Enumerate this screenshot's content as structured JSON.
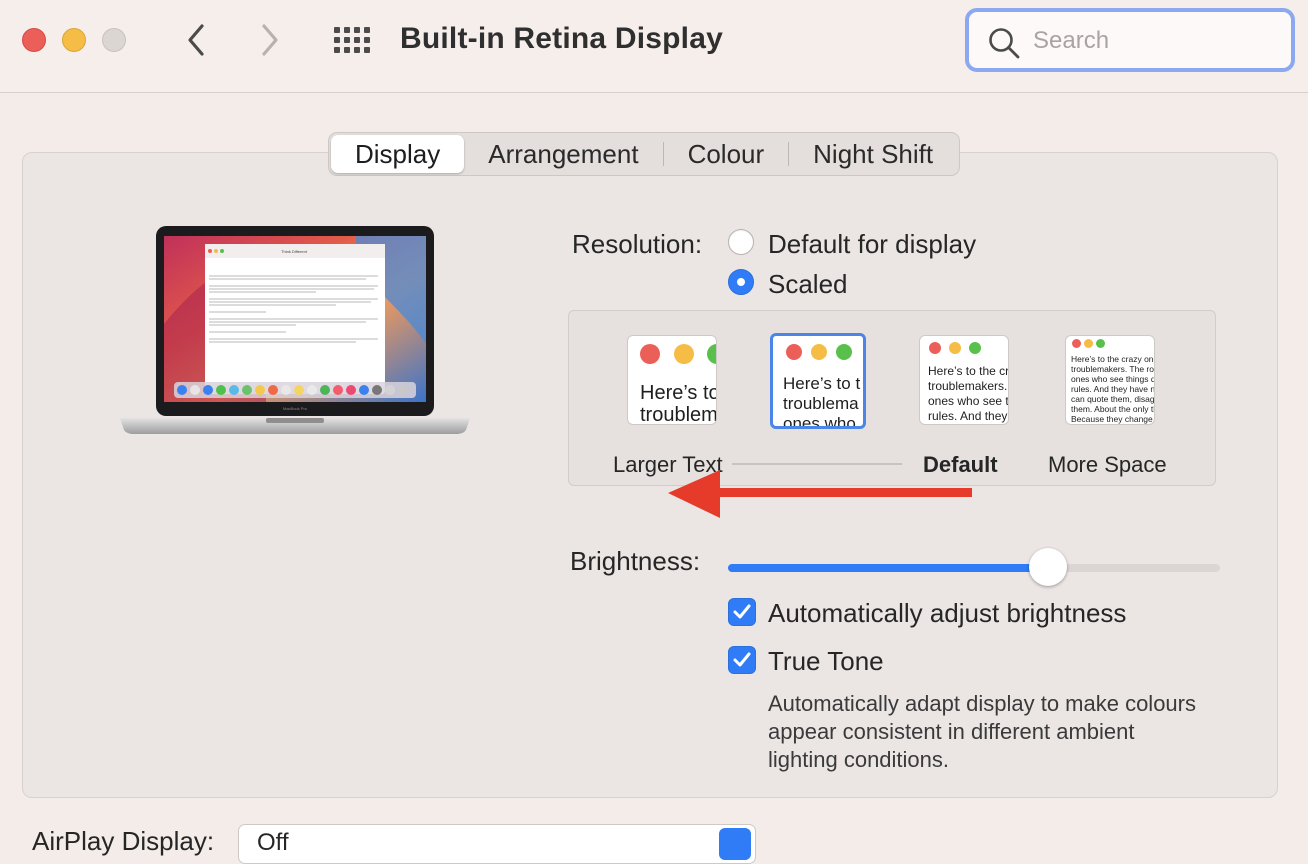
{
  "window": {
    "title": "Built-in Retina Display"
  },
  "toolbar": {
    "back_icon": "chevron-left-icon",
    "forward_icon": "chevron-right-icon",
    "grid_icon": "grid-icon",
    "search": {
      "placeholder": "Search",
      "value": ""
    }
  },
  "tabs": [
    {
      "label": "Display",
      "active": true
    },
    {
      "label": "Arrangement",
      "active": false
    },
    {
      "label": "Colour",
      "active": false
    },
    {
      "label": "Night Shift",
      "active": false
    }
  ],
  "resolution": {
    "label": "Resolution:",
    "options": [
      {
        "label": "Default for display",
        "selected": false
      },
      {
        "label": "Scaled",
        "selected": true
      }
    ]
  },
  "scaling": {
    "options": [
      {
        "sample_text": "Here’s to t\ntroublema",
        "selected": false
      },
      {
        "sample_text": "Here’s to t\ntroublema\nones who",
        "selected": true
      },
      {
        "sample_text": "Here’s to the cr\ntroublemakers.\nones who see t\nrules. And they",
        "selected": false
      },
      {
        "sample_text": "Here’s to the crazy ones\ntroublemakers. The rou\nones who see things dif\nrules. And they have no\ncan quote them, disagre\nthem. About the only th\nBecause they change th",
        "selected": false
      }
    ],
    "labels": {
      "larger_text": "Larger Text",
      "default": "Default",
      "more_space": "More Space"
    }
  },
  "brightness": {
    "label": "Brightness:",
    "level": 0.65
  },
  "checkboxes": {
    "auto_brightness": {
      "label": "Automatically adjust brightness",
      "checked": true
    },
    "true_tone": {
      "label": "True Tone",
      "checked": true
    }
  },
  "true_tone_description": [
    "Automatically adapt display to make colours",
    "appear consistent in different ambient",
    "lighting conditions."
  ],
  "airplay": {
    "label": "AirPlay Display:",
    "value": "Off"
  },
  "laptop": {
    "document_title": "Think Different",
    "device_label": "MacBook Pro"
  },
  "colors": {
    "accent": "#2f7cf6",
    "annotation_arrow": "#e63a2a",
    "close": "#ec5f58",
    "minimize": "#f5bd46",
    "zoom": "#59c14b"
  }
}
